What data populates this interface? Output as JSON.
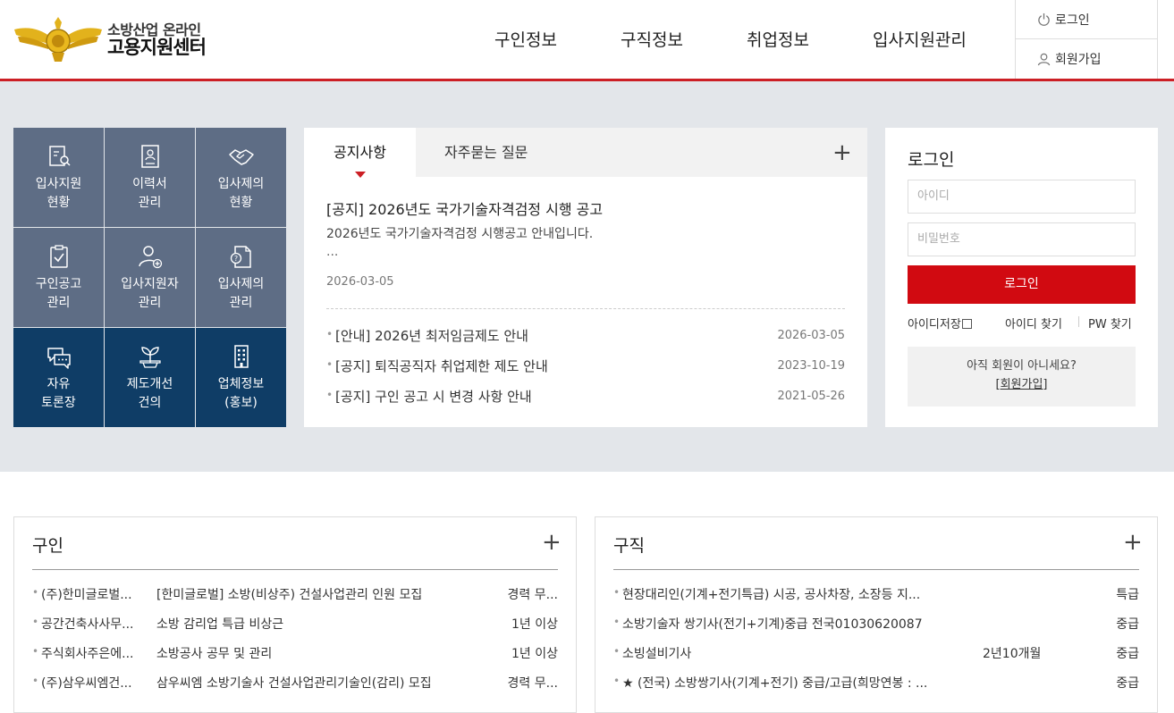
{
  "header": {
    "logo_sub": "소방산업 온라인",
    "logo_main": "고용지원센터",
    "nav": [
      "구인정보",
      "구직정보",
      "취업정보",
      "입사지원관리"
    ],
    "util_login": "로그인",
    "util_join": "회원가입"
  },
  "quick": [
    {
      "l1": "입사지원",
      "l2": "현황",
      "icon": "application-search-icon"
    },
    {
      "l1": "이력서",
      "l2": "관리",
      "icon": "resume-icon"
    },
    {
      "l1": "입사제의",
      "l2": "현황",
      "icon": "handshake-icon"
    },
    {
      "l1": "구인공고",
      "l2": "관리",
      "icon": "clipboard-check-icon"
    },
    {
      "l1": "입사지원자",
      "l2": "관리",
      "icon": "user-add-icon"
    },
    {
      "l1": "입사제의",
      "l2": "관리",
      "icon": "document-question-icon"
    },
    {
      "l1": "자유",
      "l2": "토론장",
      "icon": "chat-icon"
    },
    {
      "l1": "제도개선",
      "l2": "건의",
      "icon": "sprout-icon"
    },
    {
      "l1": "업체정보",
      "l2": "(홍보)",
      "icon": "building-icon"
    }
  ],
  "notice": {
    "tab_active": "공지사항",
    "tab_other": "자주묻는 질문",
    "featured": {
      "title": "[공지] 2026년도 국가기술자격검정 시행 공고",
      "body": "2026년도 국가기술자격검정 시행공고 안내입니다.",
      "more": "...",
      "date": "2026-03-05"
    },
    "items": [
      {
        "title": "[안내] 2026년 최저임금제도 안내",
        "date": "2026-03-05"
      },
      {
        "title": "[공지] 퇴직공직자 취업제한 제도 안내",
        "date": "2023-10-19"
      },
      {
        "title": "[공지] 구인 공고 시 변경 사항 안내",
        "date": "2021-05-26"
      }
    ]
  },
  "login": {
    "title": "로그인",
    "id_placeholder": "아이디",
    "pw_placeholder": "비밀번호",
    "button": "로그인",
    "save_id": "아이디저장",
    "find_id": "아이디 찾기",
    "find_pw": "PW 찾기",
    "not_member": "아직 회원이 아니세요?",
    "join": "[회원가입]"
  },
  "jobs": {
    "title": "구인",
    "rows": [
      {
        "company": "(주)한미글로벌...",
        "title": "[한미글로벌] 소방(비상주) 건설사업관리 인원 모집",
        "career": "경력 무..."
      },
      {
        "company": "공간건축사사무...",
        "title": "소방 감리업 특급 비상근",
        "career": "1년 이상"
      },
      {
        "company": "주식회사주은에...",
        "title": "소방공사 공무 및 관리",
        "career": "1년 이상"
      },
      {
        "company": "(주)삼우씨엠건...",
        "title": "삼우씨엠 소방기술사 건설사업관리기술인(감리) 모집",
        "career": "경력 무..."
      }
    ]
  },
  "seekers": {
    "title": "구직",
    "rows": [
      {
        "title": "현장대리인(기계+전기특급) 시공, 공사차장, 소장등 지...",
        "career": "",
        "grade": "특급"
      },
      {
        "title": "소방기술자 쌍기사(전기+기계)중급 전국01030620087",
        "career": "",
        "grade": "중급"
      },
      {
        "title": "소빙설비기사",
        "career": "2년10개월",
        "grade": "중급"
      },
      {
        "title": "★ (전국) 소방쌍기사(기계+전기) 중급/고급(희망연봉 : ...",
        "career": "",
        "grade": "중급"
      }
    ]
  },
  "colors": {
    "accent_red": "#cc1f25",
    "quick_light": "#5e6d85",
    "quick_dark": "#0f3d66",
    "band": "#e3e6ea"
  }
}
